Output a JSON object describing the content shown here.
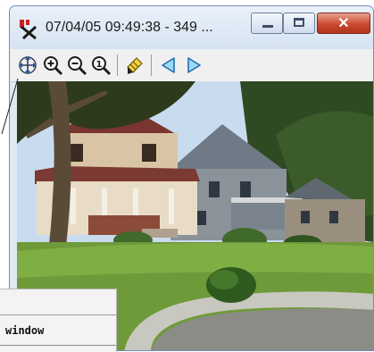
{
  "window": {
    "title": "07/04/05 09:49:38 - 349 ...",
    "controls": [
      "minimize",
      "maximize",
      "close"
    ]
  },
  "toolbar": {
    "items": [
      {
        "icon": "pan-icon",
        "name": "pan"
      },
      {
        "icon": "zoom-in-icon",
        "name": "zoom in"
      },
      {
        "icon": "zoom-out-icon",
        "name": "zoom out"
      },
      {
        "icon": "zoom-1to1-icon",
        "name": "zoom 1:1",
        "glyph": "1"
      },
      {
        "icon": "highlighter-icon",
        "name": "highlight"
      },
      {
        "icon": "previous-icon",
        "name": "previous"
      },
      {
        "icon": "next-icon",
        "name": "next"
      }
    ]
  },
  "image": {
    "subject": "residential street with houses, trees and lawn"
  },
  "callout": {
    "label": "window"
  }
}
